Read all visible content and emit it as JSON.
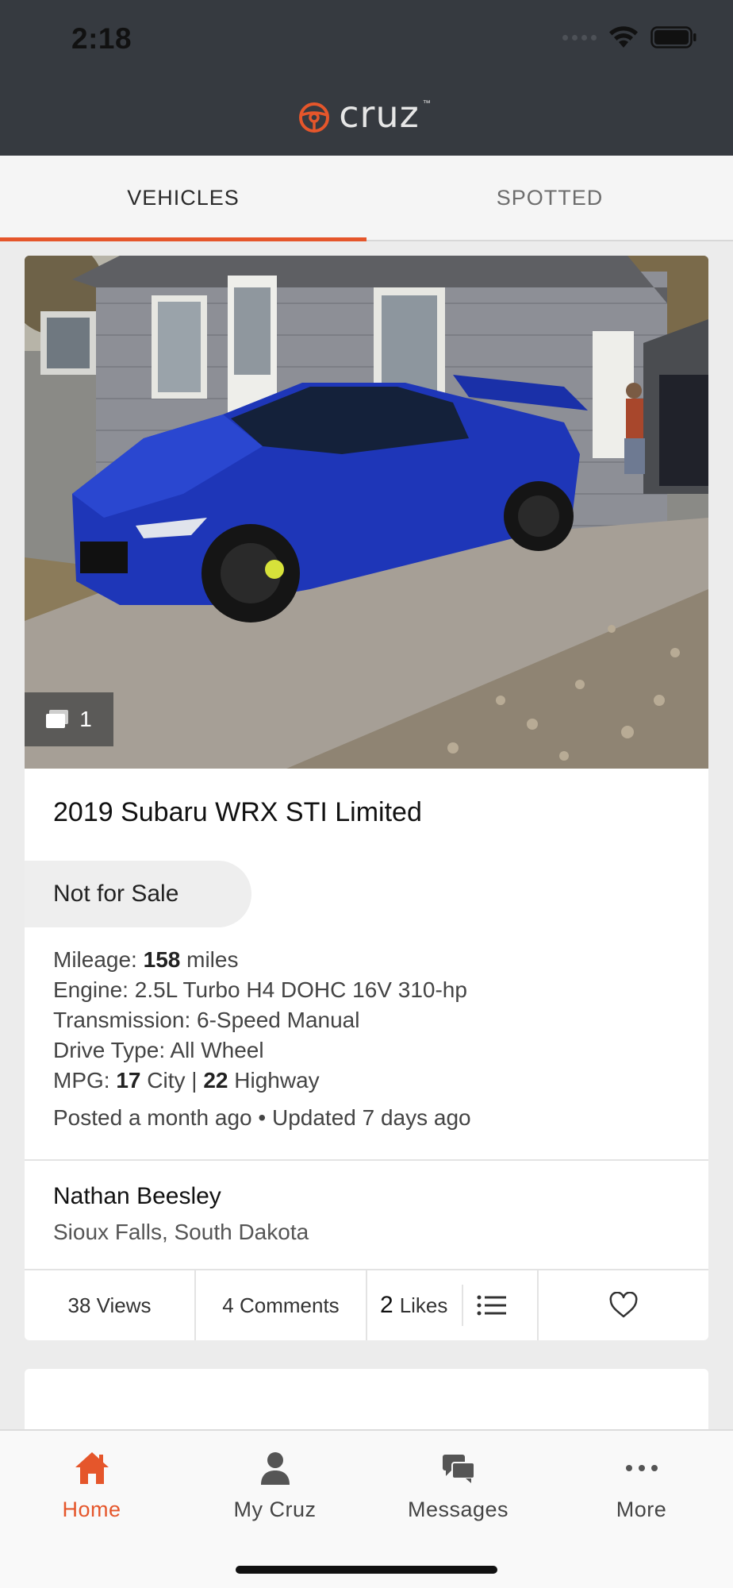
{
  "status_bar": {
    "time": "2:18"
  },
  "app": {
    "brand_name": "cruz",
    "brand_tm": "™",
    "accent_color": "#e5562b",
    "header_color": "#363a40"
  },
  "tabs": [
    {
      "label": "VEHICLES",
      "active": true
    },
    {
      "label": "SPOTTED",
      "active": false
    }
  ],
  "vehicle_card": {
    "photo_count": "1",
    "title": "2019 Subaru WRX STI Limited",
    "sale_status": "Not for Sale",
    "mileage": {
      "label": "Mileage:",
      "value": "158",
      "unit": "miles"
    },
    "engine": "Engine: 2.5L Turbo H4 DOHC 16V 310-hp",
    "transmission": "Transmission: 6-Speed Manual",
    "drive_type": "Drive Type: All Wheel",
    "mpg": {
      "label": "MPG:",
      "city": "17",
      "city_label": "City |",
      "highway": "22",
      "highway_label": "Highway"
    },
    "posted": "Posted a month ago • Updated 7 days ago",
    "owner": {
      "name": "Nathan Beesley",
      "location": "Sioux Falls, South Dakota"
    },
    "stats": {
      "views": "38 Views",
      "comments": "4 Comments",
      "likes_count": "2",
      "likes_label": "Likes"
    }
  },
  "bottom_nav": [
    {
      "label": "Home",
      "icon": "home-icon",
      "active": true
    },
    {
      "label": "My Cruz",
      "icon": "person-icon",
      "active": false
    },
    {
      "label": "Messages",
      "icon": "chat-bubbles-icon",
      "active": false
    },
    {
      "label": "More",
      "icon": "more-dots-icon",
      "active": false
    }
  ]
}
